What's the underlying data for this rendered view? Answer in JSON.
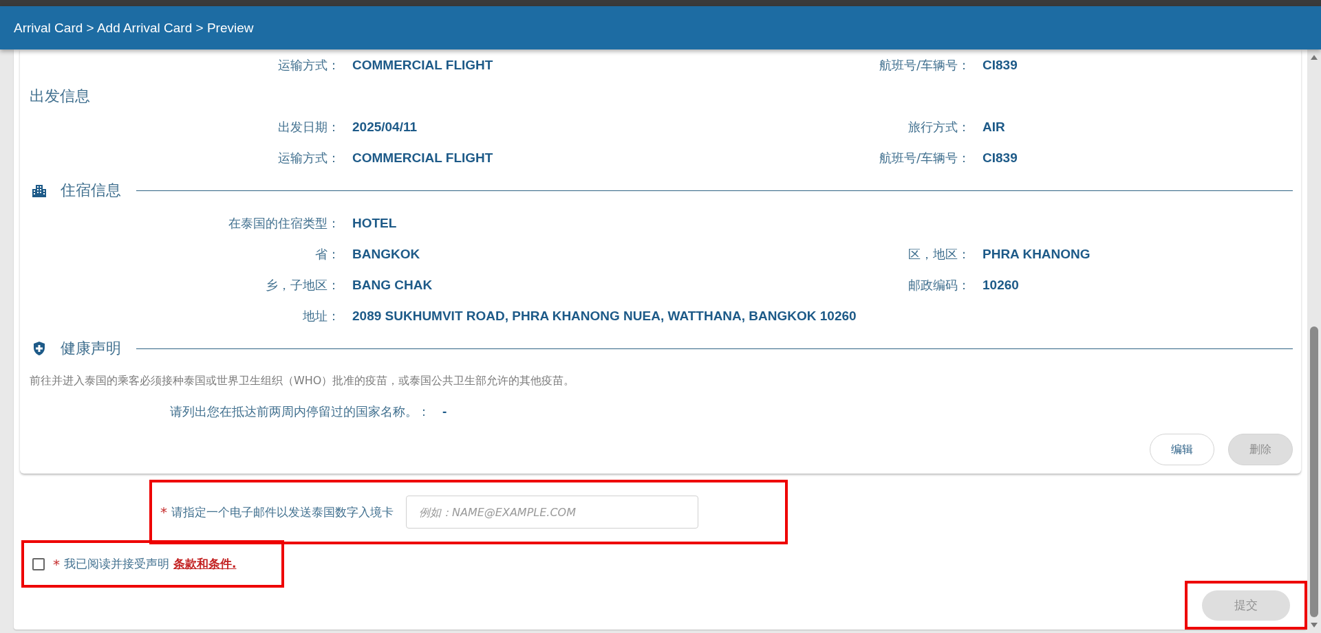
{
  "breadcrumb": "Arrival Card > Add Arrival Card > Preview",
  "sections": [
    {
      "kind": "continued",
      "rows": [
        {
          "kind": "pair",
          "left": {
            "label": "运输方式：",
            "value": "COMMERCIAL FLIGHT"
          },
          "right": {
            "label": "航班号/车辆号：",
            "value": "CI839"
          }
        }
      ]
    },
    {
      "kind": "plain",
      "title": "出发信息",
      "rows": [
        {
          "kind": "pair",
          "left": {
            "label": "出发日期：",
            "value": "2025/04/11"
          },
          "right": {
            "label": "旅行方式：",
            "value": "AIR"
          }
        },
        {
          "kind": "pair",
          "left": {
            "label": "运输方式：",
            "value": "COMMERCIAL FLIGHT"
          },
          "right": {
            "label": "航班号/车辆号：",
            "value": "CI839"
          }
        }
      ]
    },
    {
      "kind": "lodging",
      "title": "住宿信息",
      "rows": [
        {
          "kind": "pair",
          "left": {
            "label": "在泰国的住宿类型：",
            "value": "HOTEL"
          }
        },
        {
          "kind": "pair",
          "left": {
            "label": "省：",
            "value": "BANGKOK"
          },
          "right": {
            "label": "区，地区：",
            "value": "PHRA KHANONG"
          }
        },
        {
          "kind": "pair",
          "left": {
            "label": "乡，子地区：",
            "value": "BANG CHAK"
          },
          "right": {
            "label": "邮政编码：",
            "value": "10260"
          }
        },
        {
          "kind": "pair",
          "left": {
            "label": "地址：",
            "value": "2089 SUKHUMVIT ROAD, PHRA KHANONG NUEA, WATTHANA, BANGKOK 10260"
          }
        }
      ]
    },
    {
      "kind": "health",
      "title": "健康声明",
      "note": "前往并进入泰国的乘客必须接种泰国或世界卫生组织（WHO）批准的疫苗，或泰国公共卫生部允许的其他疫苗。",
      "rows": [
        {
          "kind": "wide",
          "left": {
            "label": "请列出您在抵达前两周内停留过的国家名称。：",
            "value": "-"
          }
        }
      ]
    }
  ],
  "card_buttons": [
    {
      "label": "编辑",
      "disabled": false
    },
    {
      "label": "删除",
      "disabled": true
    }
  ],
  "email": {
    "required_mark": "*",
    "label": "请指定一个电子邮件以发送泰国数字入境卡",
    "placeholder": "例如：NAME@EXAMPLE.COM",
    "highlighted": true
  },
  "consent": {
    "checked": false,
    "required_mark": "*",
    "text": "我已阅读并接受声明",
    "link": "条款和条件.",
    "highlighted": true
  },
  "submit": {
    "label": "提交",
    "disabled": true,
    "highlighted": true
  }
}
